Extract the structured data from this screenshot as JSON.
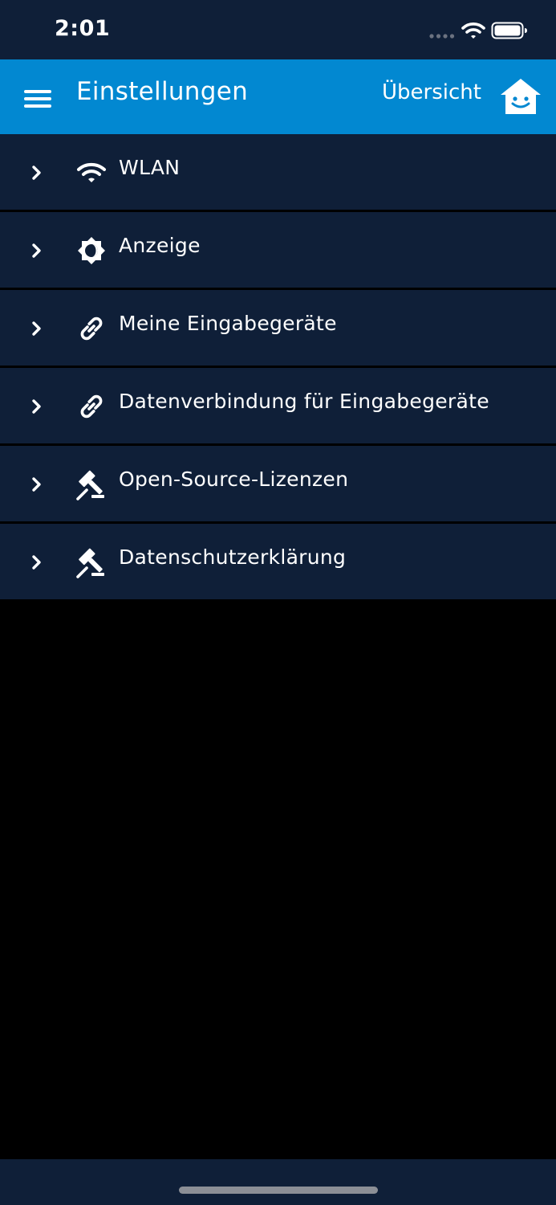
{
  "status_bar": {
    "time": "2:01",
    "icons": [
      "signal-dots-icon",
      "wifi-icon",
      "battery-icon"
    ]
  },
  "header": {
    "title": "Einstellungen",
    "overview_label": "Übersicht",
    "menu_icon": "hamburger-menu-icon",
    "home_icon": "smiling-house-icon",
    "background_color": "#0288d1"
  },
  "settings": {
    "items": [
      {
        "label": "WLAN",
        "icon": "wifi-icon"
      },
      {
        "label": "Anzeige",
        "icon": "brightness-icon"
      },
      {
        "label": "Meine Eingabegeräte",
        "icon": "link-icon"
      },
      {
        "label": "Datenverbindung für Eingabegeräte",
        "icon": "link-icon"
      },
      {
        "label": "Open-Source-Lizenzen",
        "icon": "gavel-icon"
      },
      {
        "label": "Datenschutzerklärung",
        "icon": "gavel-icon"
      }
    ]
  },
  "colors": {
    "row_background": "#0f1f38",
    "page_background": "#000000",
    "text": "#ffffff"
  }
}
